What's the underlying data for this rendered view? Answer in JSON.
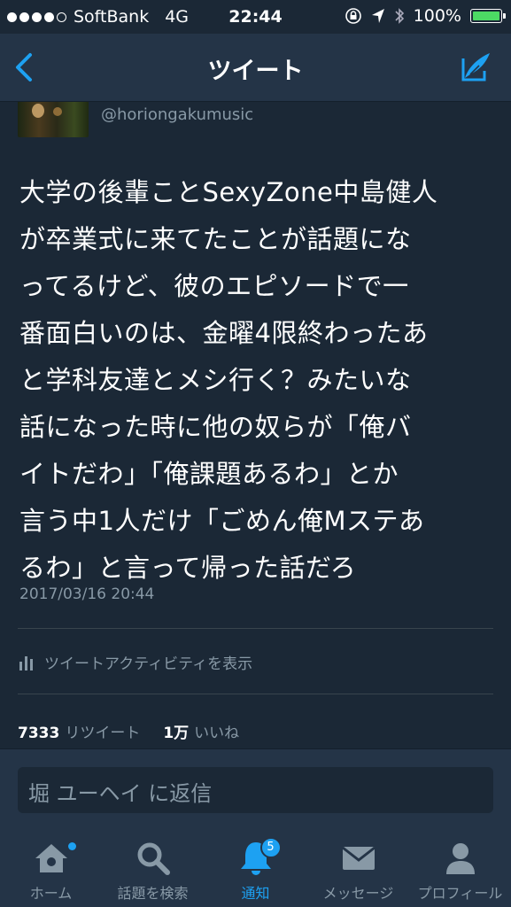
{
  "status_bar": {
    "carrier": "SoftBank",
    "network": "4G",
    "time": "22:44",
    "battery": "100%",
    "battery_level": 1.0,
    "signal_bars": 4
  },
  "nav": {
    "title": "ツイート",
    "back_icon": "chevron-left-icon",
    "compose_icon": "compose-tweet-icon"
  },
  "tweet": {
    "handle": "@horiongakumusic",
    "text_lines": [
      "大学の後輩ことSexyZone中島健人",
      "が卒業式に来てたことが話題にな",
      "ってるけど、彼のエピソードで一",
      "番面白いのは、金曜4限終わったあ",
      "と学科友達とメシ行く？みたいな",
      "話になった時に他の奴らが「俺バ",
      "イトだわ」「俺課題あるわ」とか",
      "言う中1人だけ「ごめん俺Mステあ",
      "るわ」と言って帰った話だろ"
    ],
    "timestamp": "2017/03/16 20:44",
    "activity_label": "ツイートアクティビティを表示",
    "retweet_count": "7333",
    "retweet_label": "リツイート",
    "like_count": "1万",
    "like_label": "いいね"
  },
  "reply": {
    "placeholder": "堀 ユーヘイ に返信"
  },
  "tabs": [
    {
      "label": "ホーム",
      "icon": "home-icon",
      "active": false
    },
    {
      "label": "話題を検索",
      "icon": "search-icon",
      "active": false
    },
    {
      "label": "通知",
      "icon": "bell-icon",
      "active": true,
      "badge": "5"
    },
    {
      "label": "メッセージ",
      "icon": "envelope-icon",
      "active": false
    },
    {
      "label": "プロフィール",
      "icon": "profile-icon",
      "active": false
    }
  ],
  "colors": {
    "background": "#1b2836",
    "bar": "#243447",
    "accent": "#1da1f2",
    "muted": "#8899a6",
    "battery": "#4cd964"
  }
}
